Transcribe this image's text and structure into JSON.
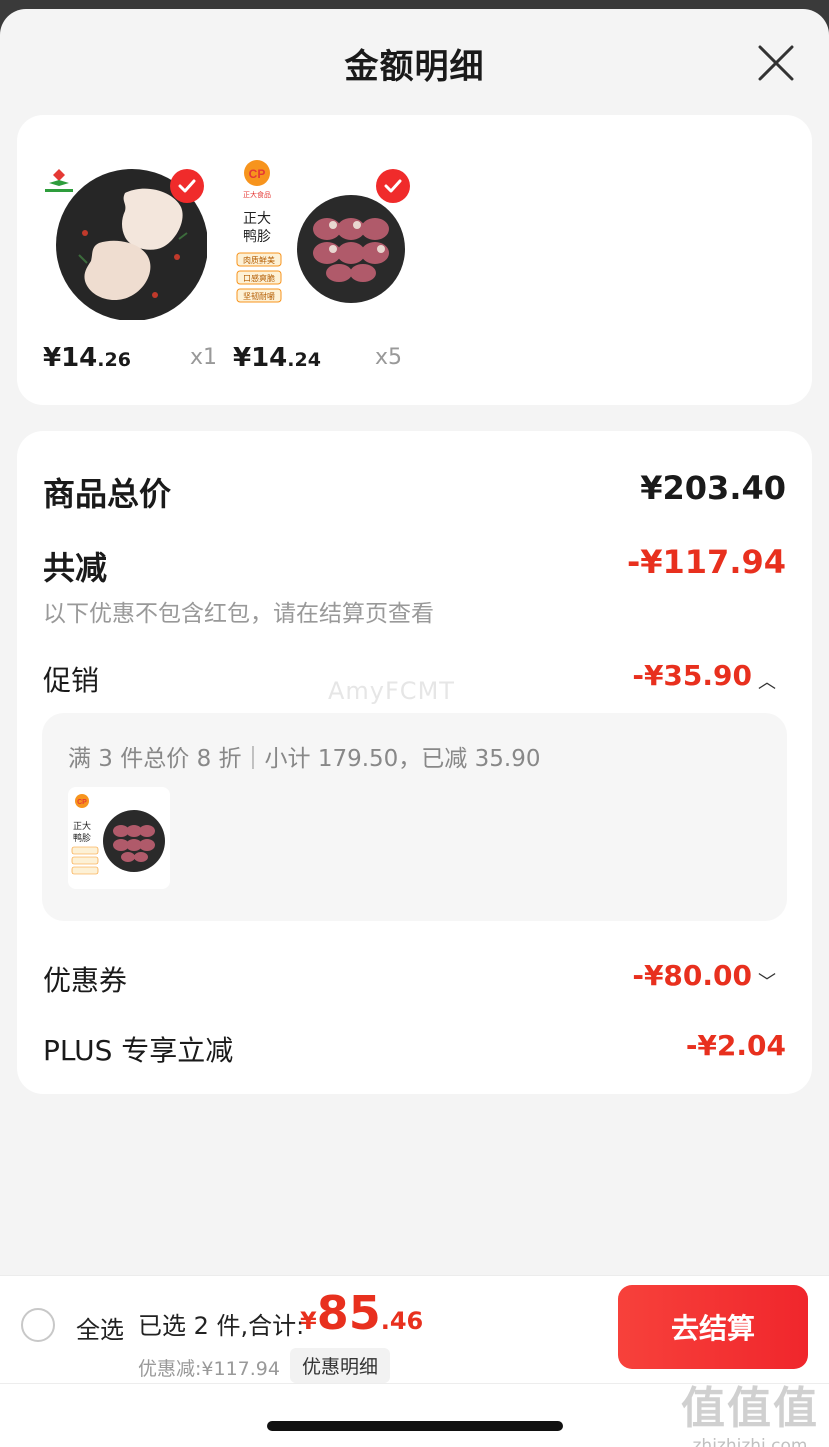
{
  "header": {
    "title": "金额明细"
  },
  "products": [
    {
      "price_int": "¥14",
      "price_dec": ".26",
      "qty": "x1",
      "brand_logo": "green-brand-logo"
    },
    {
      "price_int": "¥14",
      "price_dec": ".24",
      "qty": "x5",
      "brand": "CP",
      "brand_sub": "正大食品",
      "name": "正大\n鸭胗",
      "tags": [
        "肉质鲜美",
        "口感爽脆",
        "坚韧耐嚼"
      ]
    }
  ],
  "summary": {
    "total_label": "商品总价",
    "total_value": "¥203.40",
    "reduce_label": "共减",
    "reduce_value": "-¥117.94",
    "reduce_note": "以下优惠不包含红包，请在结算页查看",
    "promo_label": "促销",
    "promo_value": "-¥35.90",
    "promo_detail": "满 3 件总价 8 折｜小计 179.50，已减 35.90",
    "coupon_label": "优惠券",
    "coupon_value": "-¥80.00",
    "plus_label": "PLUS 专享立减",
    "plus_value": "-¥2.04"
  },
  "watermark": "AmyFCMT",
  "footer": {
    "select_all": "全选",
    "selected_info": "已选 2 件,合计:",
    "total_yen": "¥",
    "total_int": "85",
    "total_dec": ".46",
    "saved": "优惠减:¥117.94",
    "detail_button": "优惠明细",
    "checkout_button": "去结算",
    "site_glyphs": "值值值",
    "site_url": "zhizhizhi.com"
  },
  "colors": {
    "accent": "#e8301e",
    "checkout": "#f0262c"
  }
}
